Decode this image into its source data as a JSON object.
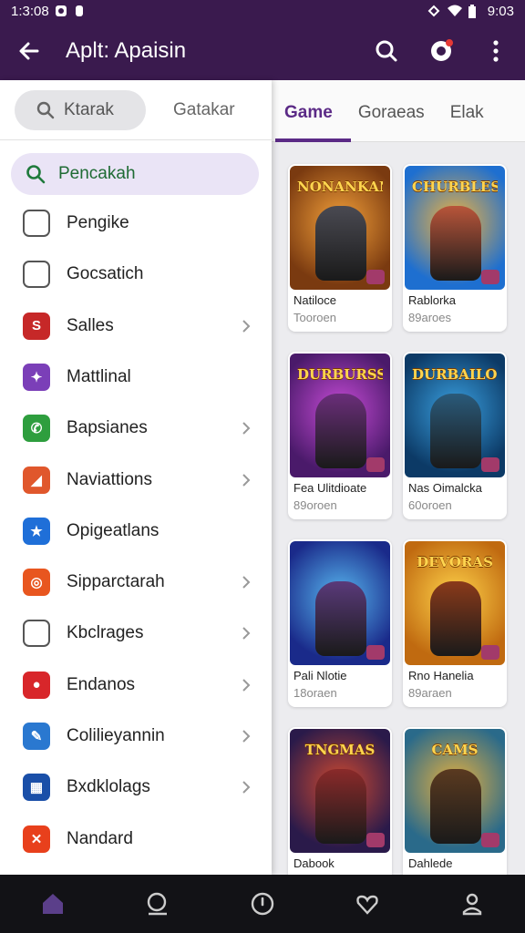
{
  "status_bar": {
    "time": "1:3:08",
    "clock": "9:03"
  },
  "app_bar": {
    "title": "Aplt: Apaisin"
  },
  "content": {
    "tabs": [
      {
        "label": "Game",
        "active": true
      },
      {
        "label": "Goraeas",
        "active": false
      },
      {
        "label": "Elak",
        "active": false
      }
    ],
    "games": [
      {
        "banner": "NONANKAN",
        "name": "Natiloce",
        "sub": "Tooroen",
        "colors": [
          "#7a3a10",
          "#f4a13a"
        ],
        "figure": "#4a4a52"
      },
      {
        "banner": "CHURBLES",
        "name": "Rablorka",
        "sub": "89aroes",
        "colors": [
          "#1e6fd0",
          "#f2b33d"
        ],
        "figure": "#b8553a"
      },
      {
        "banner": "DURBURSS",
        "name": "Fea Ulitdioate",
        "sub": "89oroen",
        "colors": [
          "#4a1a6a",
          "#c64bd6"
        ],
        "figure": "#6a2e7a"
      },
      {
        "banner": "DURBAILON",
        "name": "Nas Oimalcka",
        "sub": "60oroen",
        "colors": [
          "#0c3a66",
          "#3aa0e0"
        ],
        "figure": "#2a5a7a"
      },
      {
        "banner": "",
        "name": "Pali Nlotie",
        "sub": "18oraen",
        "colors": [
          "#1a2a8a",
          "#58b8f0"
        ],
        "figure": "#5a3a7a"
      },
      {
        "banner": "DEVORAS",
        "name": "Rno Hanelia",
        "sub": "89araen",
        "colors": [
          "#c06a10",
          "#ffd34a"
        ],
        "figure": "#8a3a1a"
      },
      {
        "banner": "TNGMAS",
        "name": "Dabook",
        "sub": "",
        "colors": [
          "#2a1a4a",
          "#d04a30"
        ],
        "figure": "#8a2a2a"
      },
      {
        "banner": "CAMS",
        "name": "Dahlede",
        "sub": "",
        "colors": [
          "#2a6a8a",
          "#e6b040"
        ],
        "figure": "#5a3a20"
      }
    ]
  },
  "drawer": {
    "pill_label": "Ktarak",
    "tab2_label": "Gatakar",
    "search_label": "Pencakah",
    "items": [
      {
        "label": "Pengike",
        "icon": "document-icon",
        "color": "#ffffff",
        "glyph": "",
        "chevron": false
      },
      {
        "label": "Gocsatich",
        "icon": "mail-icon",
        "color": "#ffffff",
        "glyph": "",
        "chevron": false
      },
      {
        "label": "Salles",
        "icon": "sales-app-icon",
        "color": "#c62828",
        "glyph": "S",
        "chevron": true
      },
      {
        "label": "Mattlinal",
        "icon": "puzzle-icon",
        "color": "#7b3fb8",
        "glyph": "✦",
        "chevron": false
      },
      {
        "label": "Bapsianes",
        "icon": "chat-icon",
        "color": "#2e9e3e",
        "glyph": "✆",
        "chevron": true
      },
      {
        "label": "Naviattions",
        "icon": "navigation-icon",
        "color": "#e0572c",
        "glyph": "◢",
        "chevron": true
      },
      {
        "label": "Opigeatlans",
        "icon": "star-app-icon",
        "color": "#1f6fd8",
        "glyph": "★",
        "chevron": false
      },
      {
        "label": "Sipparctarah",
        "icon": "target-icon",
        "color": "#e8561f",
        "glyph": "◎",
        "chevron": true
      },
      {
        "label": "Kbclrages",
        "icon": "envelope-icon",
        "color": "#ffffff",
        "glyph": "",
        "chevron": true
      },
      {
        "label": "Endanos",
        "icon": "record-icon",
        "color": "#d8262a",
        "glyph": "●",
        "chevron": true
      },
      {
        "label": "Colilieyannin",
        "icon": "tools-icon",
        "color": "#2a78d0",
        "glyph": "✎",
        "chevron": true
      },
      {
        "label": "Bxdklolags",
        "icon": "keyboard-icon",
        "color": "#1a4fa8",
        "glyph": "▦",
        "chevron": true
      },
      {
        "label": "Nandard",
        "icon": "cross-icon",
        "color": "#e8401c",
        "glyph": "✕",
        "chevron": false
      }
    ]
  }
}
